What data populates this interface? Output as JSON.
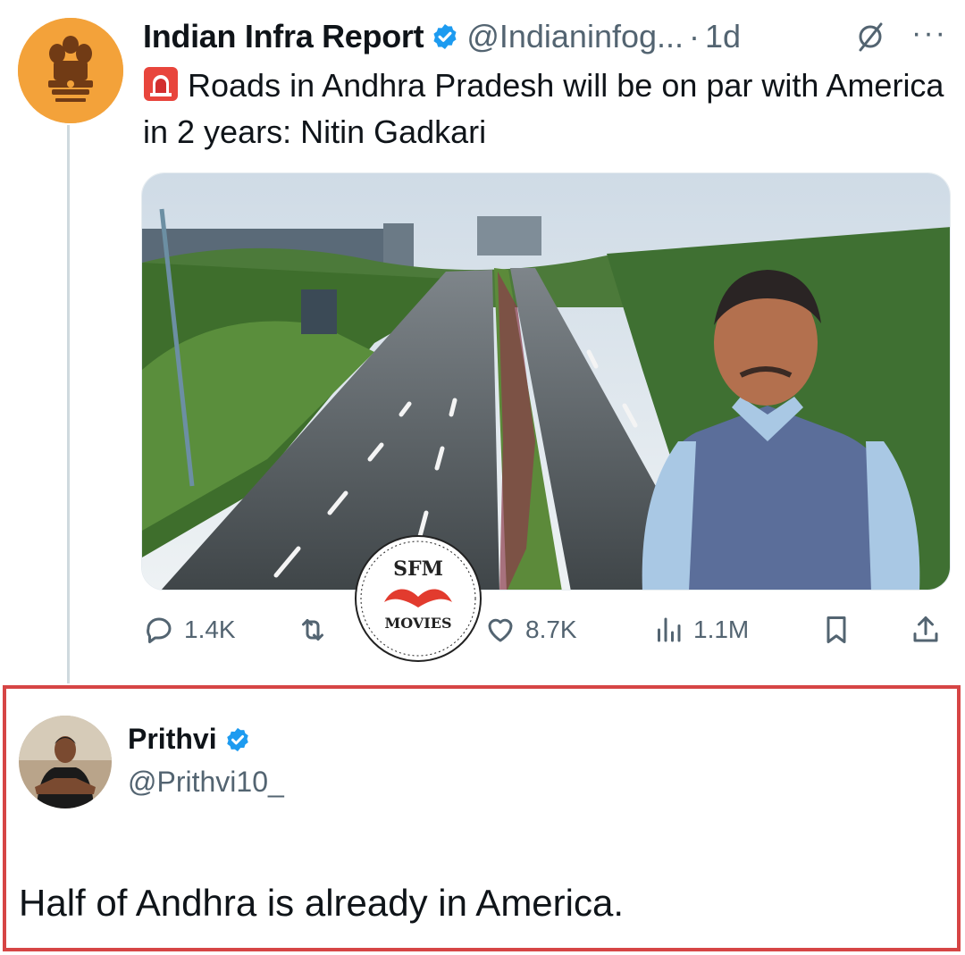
{
  "tweet": {
    "author_name": "Indian Infra Report",
    "author_handle": "@Indianinfog...",
    "separator": "·",
    "time": "1d",
    "more_label": "···",
    "text": "Roads in Andhra Pradesh will be on par with America in 2 years: Nitin Gadkari",
    "avatar_icon": "emblem-icon",
    "text_emoji_icon": "siren-icon",
    "media": {
      "description_icon": "highway-photo",
      "watermark_top": "SFM",
      "watermark_bottom": "MOVIES"
    },
    "actions": {
      "replies": "1.4K",
      "retweets": "",
      "likes": "8.7K",
      "views": "1.1M"
    }
  },
  "reply": {
    "author_name": "Prithvi",
    "author_handle": "@Prithvi10_",
    "text": "Half of Andhra is already in America.",
    "highlight_color": "#d64545"
  },
  "colors": {
    "verified": "#1d9bf0",
    "muted": "#536471",
    "thread_line": "#cfd9de",
    "avatar_bg": "#f3a23a"
  }
}
